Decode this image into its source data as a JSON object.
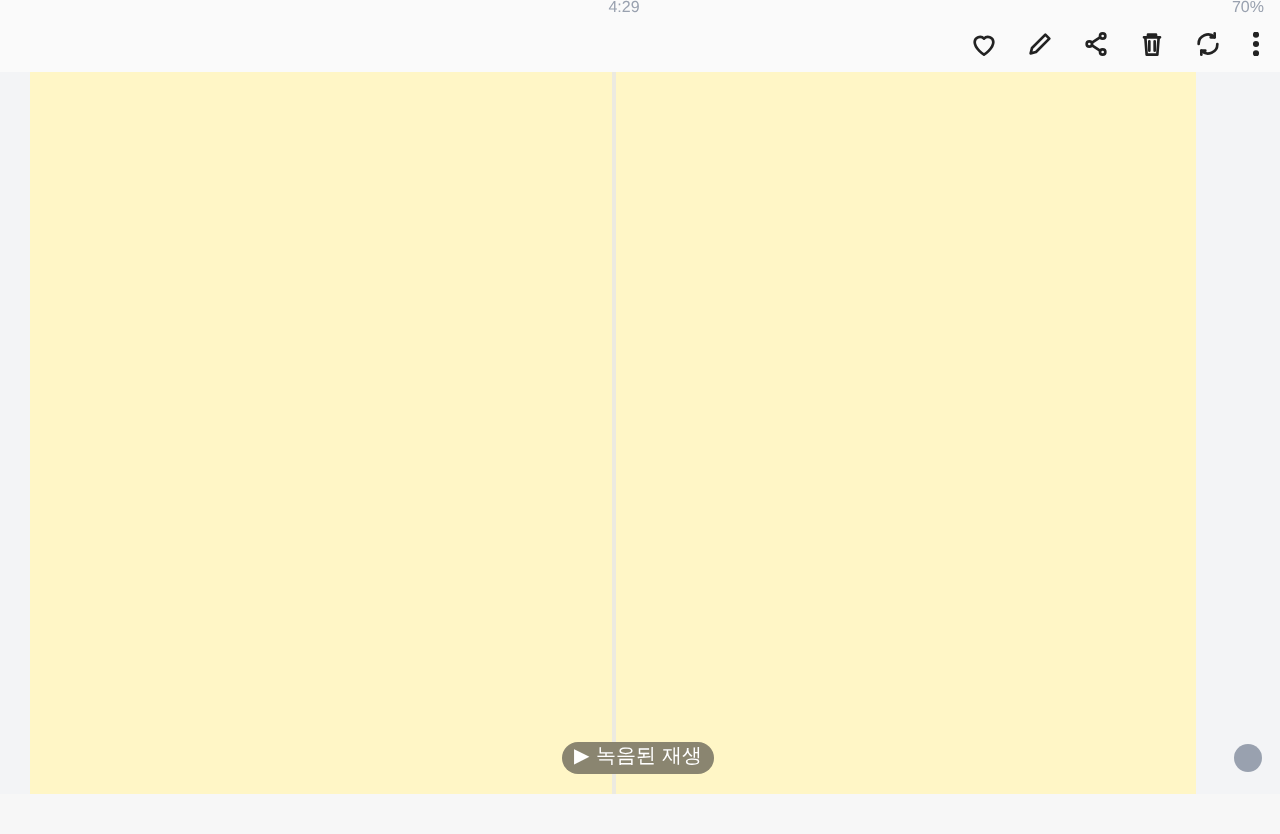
{
  "status_bar": {
    "time": "4:29",
    "battery": "70%"
  },
  "playback_button": {
    "icon": "▶",
    "label": "녹음된 재생"
  }
}
